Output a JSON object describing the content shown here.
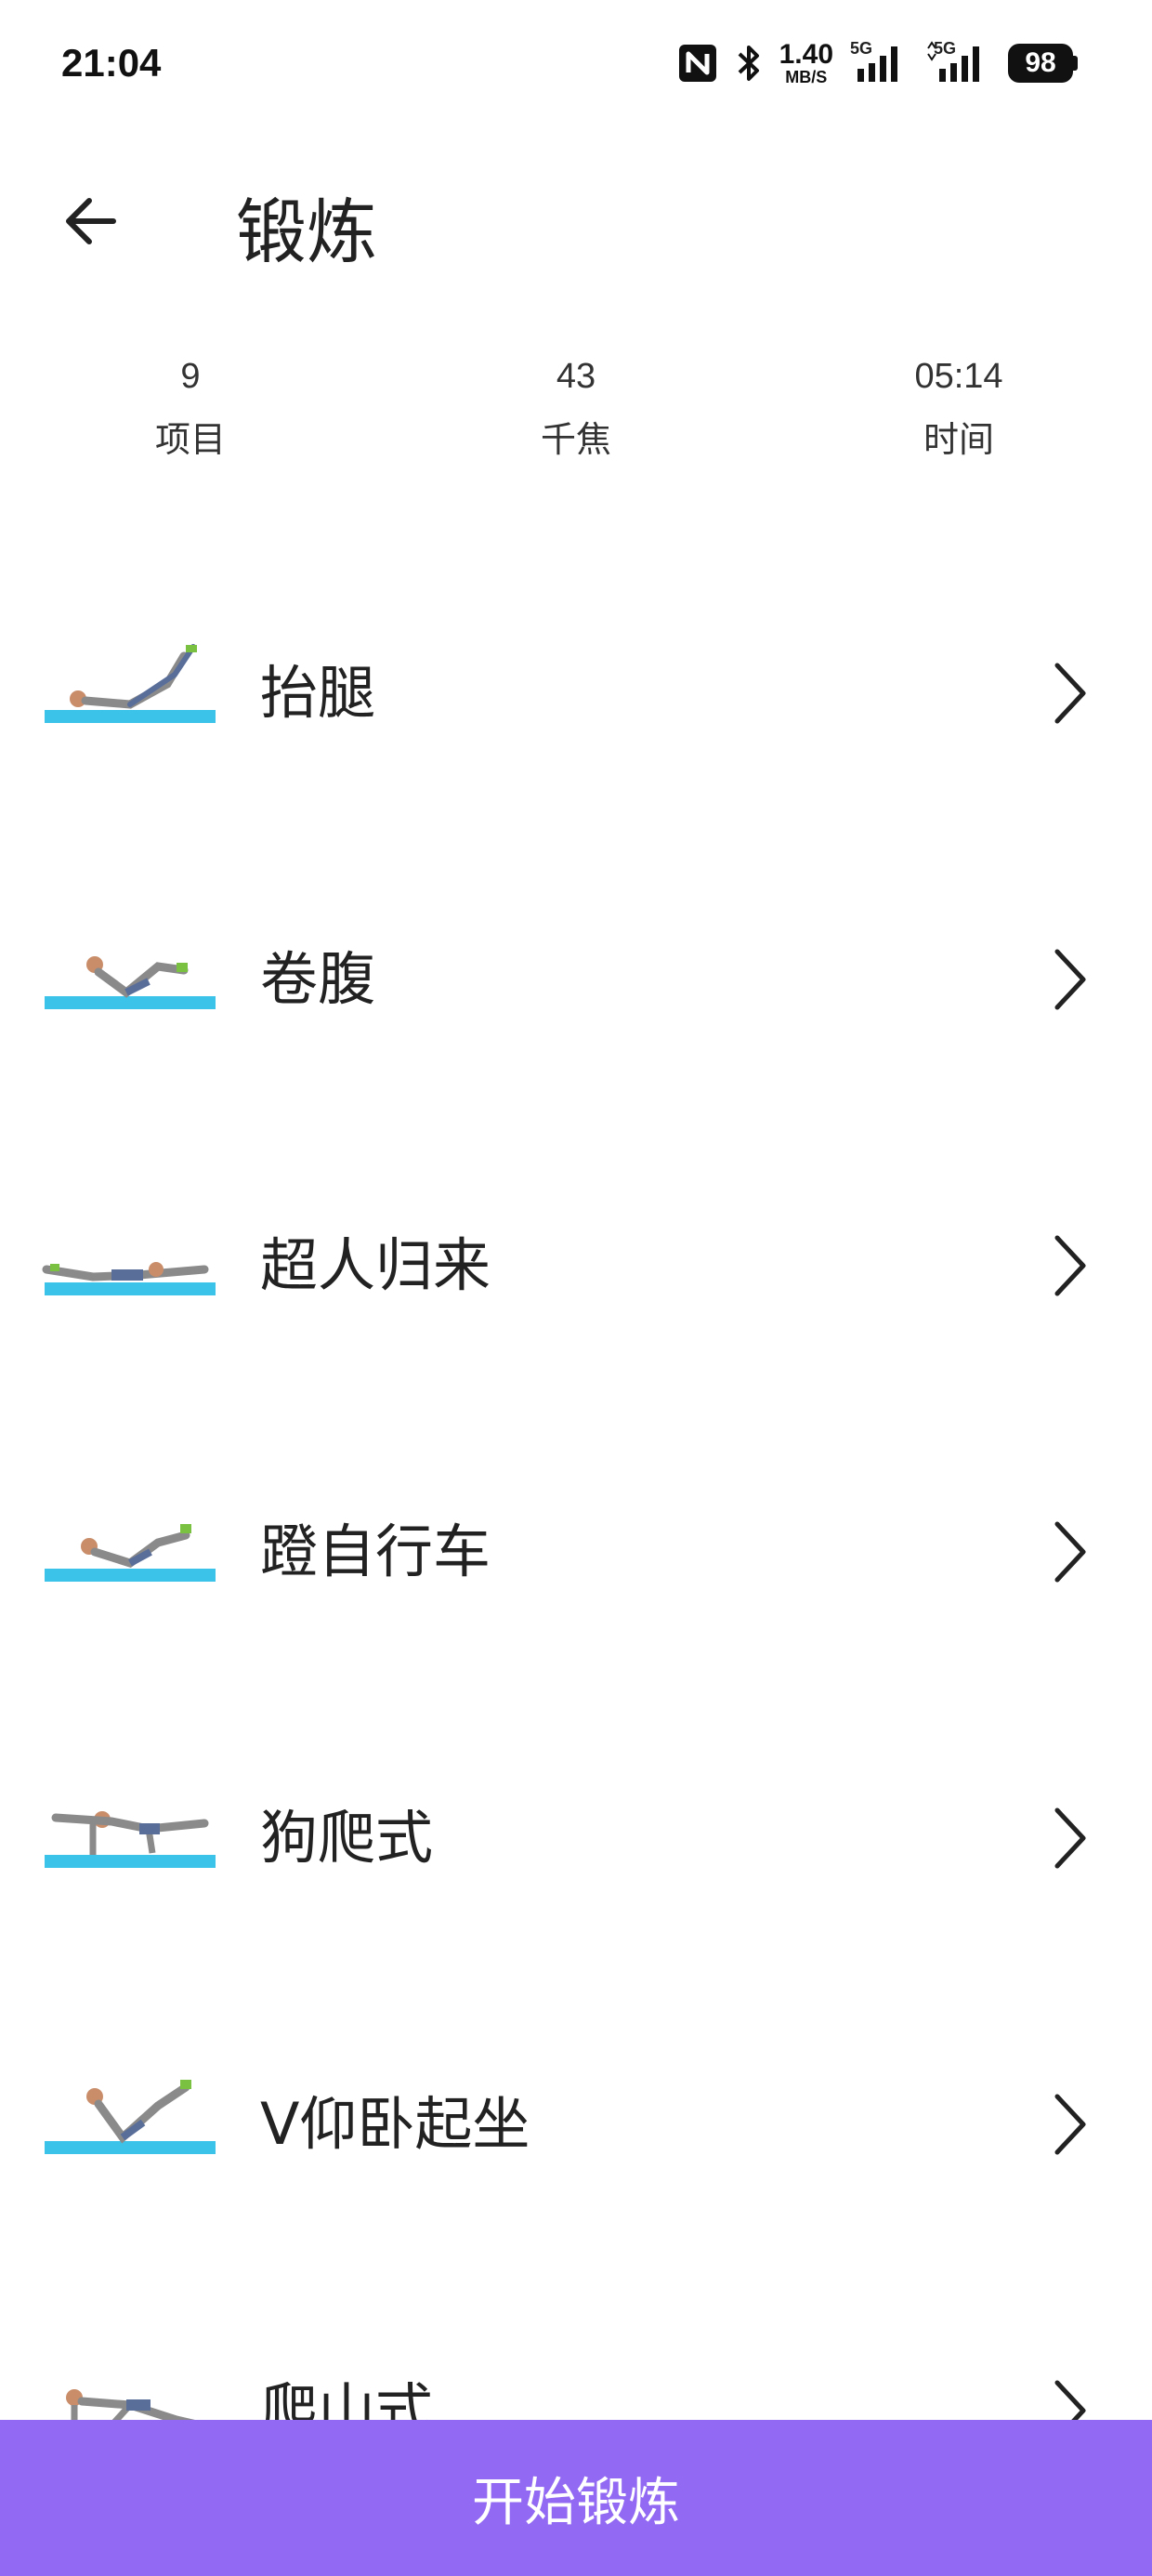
{
  "status_bar": {
    "time": "21:04",
    "net_speed_value": "1.40",
    "net_speed_unit": "MB/S",
    "signal_1_label": "5G",
    "signal_2_label": "5G",
    "battery": "98",
    "icons": [
      "nfc-icon",
      "bluetooth-icon",
      "signal-icon",
      "signal-icon",
      "battery-icon"
    ]
  },
  "header": {
    "title": "锻炼",
    "back_icon": "arrow-left-icon"
  },
  "stats": [
    {
      "value": "9",
      "label": "项目"
    },
    {
      "value": "43",
      "label": "千焦"
    },
    {
      "value": "05:14",
      "label": "时间"
    }
  ],
  "exercises": [
    {
      "name": "抬腿",
      "icon": "chevron-right-icon"
    },
    {
      "name": "卷腹",
      "icon": "chevron-right-icon"
    },
    {
      "name": "超人归来",
      "icon": "chevron-right-icon"
    },
    {
      "name": "蹬自行车",
      "icon": "chevron-right-icon"
    },
    {
      "name": "狗爬式",
      "icon": "chevron-right-icon"
    },
    {
      "name": "V仰卧起坐",
      "icon": "chevron-right-icon"
    },
    {
      "name": "爬山式",
      "icon": "chevron-right-icon"
    }
  ],
  "start_button": {
    "label": "开始锻炼",
    "color": "#9269f2"
  },
  "colors": {
    "mat": "#3cc3ea",
    "accent": "#9269f2"
  }
}
